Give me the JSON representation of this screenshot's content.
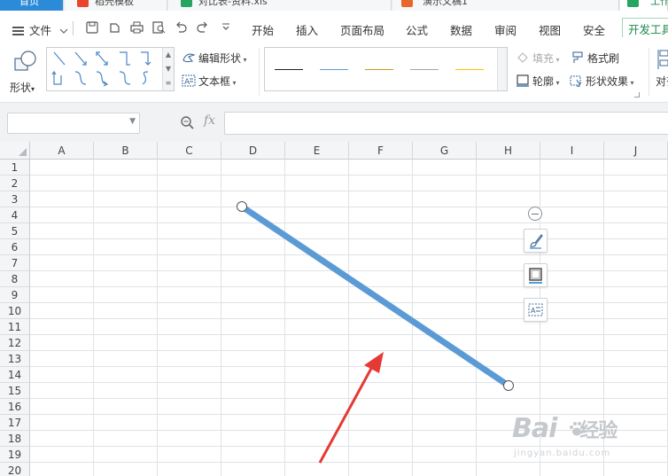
{
  "tabs": [
    {
      "label": "首页",
      "type": "home"
    },
    {
      "label": "稻壳模板",
      "type": "docer"
    },
    {
      "label": "对比表-资料.xls",
      "type": "et"
    },
    {
      "label": "演示文稿1",
      "type": "wpp"
    },
    {
      "label": "工作",
      "type": "et-active"
    }
  ],
  "menu": {
    "file_label": "文件",
    "items": [
      "开始",
      "插入",
      "页面布局",
      "公式",
      "数据",
      "审阅",
      "视图",
      "安全"
    ],
    "active_item": "开发工具"
  },
  "ribbon": {
    "shapes_label": "形状",
    "edit_shape_label": "编辑形状",
    "textbox_label": "文本框",
    "fill_label": "填充",
    "outline_label": "轮廓",
    "format_painter_label": "格式刷",
    "shape_effects_label": "形状效果",
    "align_label": "对齐",
    "line_style_colors": [
      "#222222",
      "#5b9bd5",
      "#c99a1c",
      "#a5a5a5",
      "#ffc000"
    ]
  },
  "formula_bar": {
    "name_box": "",
    "fx_label": "fx",
    "formula": ""
  },
  "columns": [
    "A",
    "B",
    "C",
    "D",
    "E",
    "F",
    "G",
    "H",
    "I",
    "J"
  ],
  "rows": [
    "1",
    "2",
    "3",
    "4",
    "5",
    "6",
    "7",
    "8",
    "9",
    "10",
    "11",
    "12",
    "13",
    "14",
    "15",
    "16",
    "17",
    "18",
    "19",
    "20"
  ],
  "shape": {
    "type": "line",
    "color": "#5b9bd5",
    "start_cell": "D3",
    "end_cell": "H15"
  },
  "floating_tools": [
    "collapse",
    "shape-style",
    "shape-outline",
    "text-wrap"
  ],
  "annotation": {
    "type": "red-arrow",
    "color": "#e53935"
  },
  "watermark": {
    "brand": "Bai",
    "brand_suffix": "经验",
    "url": "jingyan.baidu.com"
  }
}
